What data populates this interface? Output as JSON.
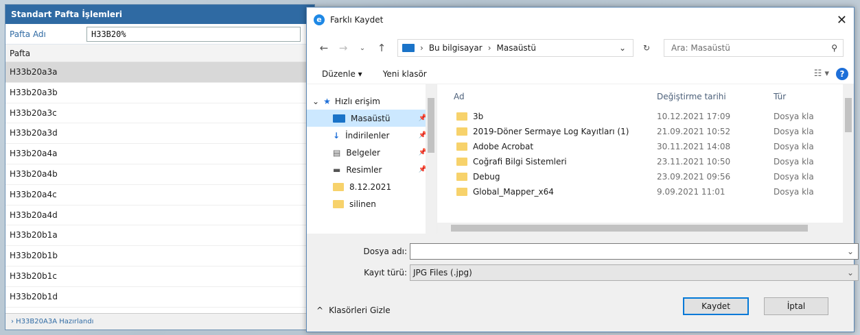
{
  "panel": {
    "title": "Standart Pafta İşlemleri",
    "name_label": "Pafta Adı",
    "name_value": "H33B20%",
    "column": "Pafta",
    "rows": [
      "H33b20a3a",
      "H33b20a3b",
      "H33b20a3c",
      "H33b20a3d",
      "H33b20a4a",
      "H33b20a4b",
      "H33b20a4c",
      "H33b20a4d",
      "H33b20b1a",
      "H33b20b1b",
      "H33b20b1c",
      "H33b20b1d"
    ],
    "status": "› H33B20A3A Hazırlandı"
  },
  "dialog": {
    "title": "Farklı Kaydet",
    "breadcrumb": [
      "Bu bilgisayar",
      "Masaüstü"
    ],
    "search_placeholder": "Ara: Masaüstü",
    "toolbar": {
      "organize": "Düzenle ▾",
      "new_folder": "Yeni klasör"
    },
    "tree": {
      "quick_access": "Hızlı erişim",
      "items": [
        "Masaüstü",
        "İndirilenler",
        "Belgeler",
        "Resimler",
        "8.12.2021",
        "silinen"
      ]
    },
    "columns": {
      "name": "Ad",
      "date": "Değiştirme tarihi",
      "type": "Tür"
    },
    "files": [
      {
        "name": "3b",
        "date": "10.12.2021 17:09",
        "type": "Dosya kla"
      },
      {
        "name": "2019-Döner Sermaye Log Kayıtları (1)",
        "date": "21.09.2021 10:52",
        "type": "Dosya kla"
      },
      {
        "name": "Adobe Acrobat",
        "date": "30.11.2021 14:08",
        "type": "Dosya kla"
      },
      {
        "name": "Coğrafi Bilgi Sistemleri",
        "date": "23.11.2021 10:50",
        "type": "Dosya kla"
      },
      {
        "name": "Debug",
        "date": "23.09.2021 09:56",
        "type": "Dosya kla"
      },
      {
        "name": "Global_Mapper_x64",
        "date": "9.09.2021 11:01",
        "type": "Dosya kla"
      }
    ],
    "filename_label": "Dosya adı:",
    "filename_value": "",
    "filetype_label": "Kayıt türü:",
    "filetype_value": "JPG Files (.jpg)",
    "hide_folders": "Klasörleri Gizle",
    "save": "Kaydet",
    "cancel": "İptal"
  },
  "colors": {
    "header_blue": "#2f6aa3",
    "selection": "#cce8ff",
    "folder": "#f7d26b"
  }
}
